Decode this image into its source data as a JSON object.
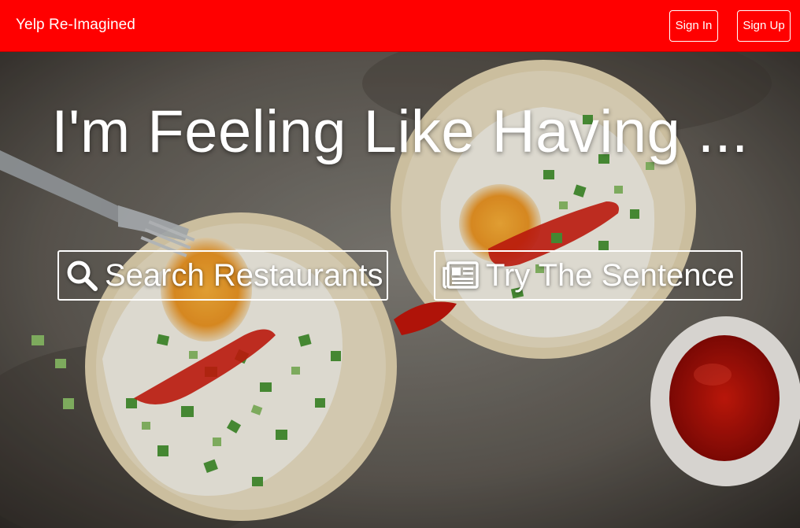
{
  "nav": {
    "brand": "Yelp Re-Imagined",
    "sign_in": "Sign In",
    "sign_up": "Sign Up"
  },
  "hero": {
    "headline": "I'm Feeling Like Having ...",
    "search_button": {
      "label": "Search Restaurants",
      "icon": "search-icon"
    },
    "sentence_button": {
      "label": "Try The Sentence",
      "icon": "newspaper-icon"
    }
  },
  "colors": {
    "nav_background": "#ff0000",
    "text": "#ffffff"
  }
}
